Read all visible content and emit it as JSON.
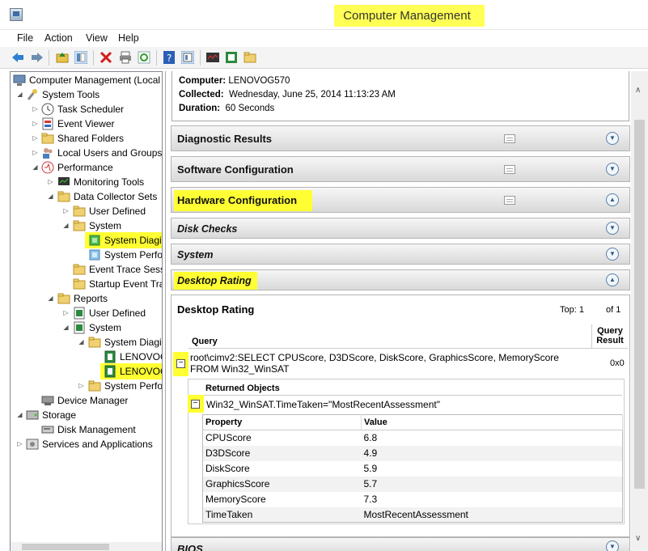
{
  "window": {
    "title": "Computer Management"
  },
  "menu": [
    "File",
    "Action",
    "View",
    "Help"
  ],
  "tree": [
    {
      "label": "Computer Management (Local",
      "hl": false
    },
    {
      "label": "System Tools",
      "hl": false
    },
    {
      "label": "Task Scheduler",
      "hl": false
    },
    {
      "label": "Event Viewer",
      "hl": false
    },
    {
      "label": "Shared Folders",
      "hl": false
    },
    {
      "label": "Local Users and Groups",
      "hl": false
    },
    {
      "label": "Performance",
      "hl": false
    },
    {
      "label": "Monitoring Tools",
      "hl": false
    },
    {
      "label": "Data Collector Sets",
      "hl": false
    },
    {
      "label": "User Defined",
      "hl": false
    },
    {
      "label": "System",
      "hl": false
    },
    {
      "label": "System Diagi",
      "hl": true
    },
    {
      "label": "System Perfo",
      "hl": false
    },
    {
      "label": "Event Trace Sess",
      "hl": false
    },
    {
      "label": "Startup Event Tra",
      "hl": false
    },
    {
      "label": "Reports",
      "hl": false
    },
    {
      "label": "User Defined",
      "hl": false
    },
    {
      "label": "System",
      "hl": false
    },
    {
      "label": "System Diagi",
      "hl": false
    },
    {
      "label": "LENOVOG",
      "hl": false
    },
    {
      "label": "LENOVOG",
      "hl": true
    },
    {
      "label": "System Perfo",
      "hl": false
    },
    {
      "label": "Device Manager",
      "hl": false
    },
    {
      "label": "Storage",
      "hl": false
    },
    {
      "label": "Disk Management",
      "hl": false
    },
    {
      "label": "Services and Applications",
      "hl": false
    }
  ],
  "report": {
    "computer_label": "Computer:",
    "computer": "LENOVOG570",
    "collected_label": "Collected:",
    "collected": "Wednesday, June 25, 2014 11:13:23 AM",
    "duration_label": "Duration:",
    "duration": "60 Seconds"
  },
  "sections": [
    {
      "title": "Diagnostic Results",
      "toggle": "collapsed"
    },
    {
      "title": "Software Configuration",
      "toggle": "collapsed"
    },
    {
      "title": "Hardware Configuration",
      "toggle": "expanded"
    },
    {
      "title": "Disk Checks",
      "toggle": "collapsed"
    },
    {
      "title": "System",
      "toggle": "collapsed"
    },
    {
      "title": "Desktop Rating",
      "toggle": "expanded"
    }
  ],
  "desktop_rating": {
    "title": "Desktop Rating",
    "top_label": "Top:",
    "top_value": "1",
    "of_label": "of",
    "of_value": "1",
    "query_header": "Query",
    "query_result_header": "Query Result",
    "query": "root\\cimv2:SELECT CPUScore, D3DScore, DiskScore, GraphicsScore, MemoryScore FROM Win32_WinSAT",
    "query_result": "0x0",
    "returned_header": "Returned Objects",
    "returned_object": "Win32_WinSAT.TimeTaken=\"MostRecentAssessment\"",
    "prop_header": "Property",
    "value_header": "Value",
    "rows": [
      {
        "property": "CPUScore",
        "value": "6.8"
      },
      {
        "property": "D3DScore",
        "value": "4.9"
      },
      {
        "property": "DiskScore",
        "value": "5.9"
      },
      {
        "property": "GraphicsScore",
        "value": "5.7"
      },
      {
        "property": "MemoryScore",
        "value": "7.3"
      },
      {
        "property": "TimeTaken",
        "value": "MostRecentAssessment"
      }
    ]
  },
  "bios": {
    "title": "BIOS"
  },
  "colors": {
    "highlight": "#ffff33",
    "toggle": "#2e5a88"
  }
}
